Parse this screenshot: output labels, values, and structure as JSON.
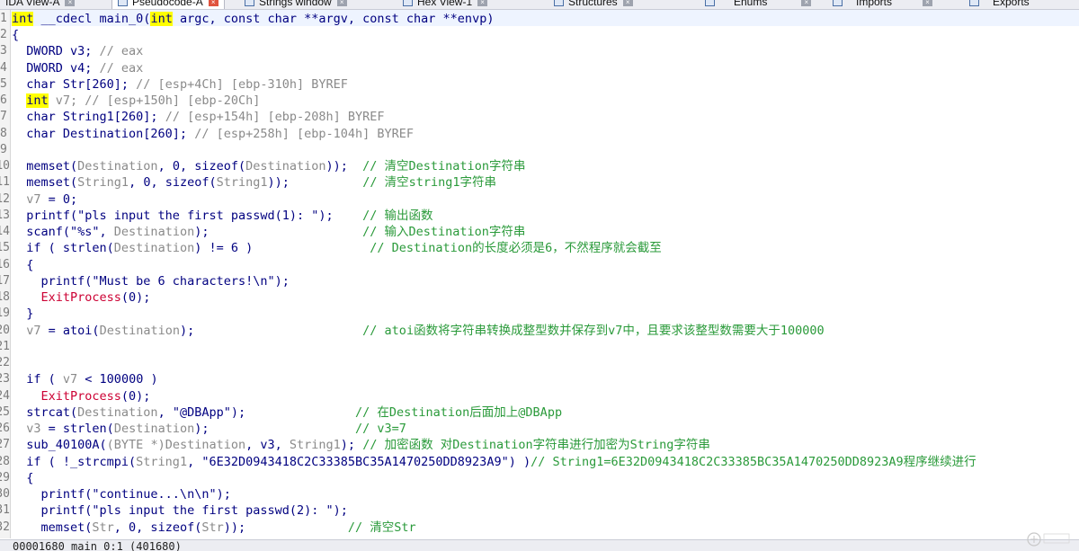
{
  "tabs": [
    {
      "label": "IDA View-A",
      "active": false
    },
    {
      "label": "Pseudocode-A",
      "active": true
    },
    {
      "label": "Strings window",
      "active": false
    },
    {
      "label": "Hex View-1",
      "active": false
    },
    {
      "label": "Structures",
      "active": false
    },
    {
      "label": "Enums",
      "active": false
    },
    {
      "label": "Imports",
      "active": false
    },
    {
      "label": "Exports",
      "active": false
    }
  ],
  "line_numbers": [
    "1",
    "2",
    "3",
    "4",
    "5",
    "6",
    "7",
    "8",
    "9",
    "10",
    "11",
    "12",
    "13",
    "14",
    "15",
    "16",
    "17",
    "18",
    "19",
    "20",
    "21",
    "22",
    "23",
    "24",
    "25",
    "26",
    "27",
    "28",
    "29",
    "30",
    "31",
    "32"
  ],
  "code": {
    "l1a": "int",
    "l1b": " __cdecl main_0(",
    "l1c": "int",
    "l1d": " argc, const char **argv, const char **envp)",
    "l2": "{",
    "l3a": "  DWORD v3; ",
    "l3b": "// eax",
    "l4a": "  DWORD v4; ",
    "l4b": "// eax",
    "l5a": "  char Str[260]; ",
    "l5b": "// [esp+4Ch] [ebp-310h] BYREF",
    "l6a": "int",
    "l6b": " v7; ",
    "l6c": "// [esp+150h] [ebp-20Ch]",
    "l7a": "  char String1[260]; ",
    "l7b": "// [esp+154h] [ebp-208h] BYREF",
    "l8a": "  char Destination[260]; ",
    "l8b": "// [esp+258h] [ebp-104h] BYREF",
    "l10a": "  memset(",
    "l10b": "Destination",
    "l10c": ", 0, sizeof(",
    "l10d": "Destination",
    "l10e": "));  ",
    "l10f": "// 清空Destination字符串",
    "l11a": "  memset(",
    "l11b": "String1",
    "l11c": ", 0, sizeof(",
    "l11d": "String1",
    "l11e": "));          ",
    "l11f": "// 清空string1字符串",
    "l12a": "  ",
    "l12b": "v7",
    "l12c": " = 0;",
    "l13a": "  printf(\"pls input the first passwd(1): \");    ",
    "l13b": "// 输出函数",
    "l14a": "  scanf(\"%s\", ",
    "l14b": "Destination",
    "l14c": ");                     ",
    "l14d": "// 输入Destination字符串",
    "l15a": "  if ( strlen(",
    "l15b": "Destination",
    "l15c": ") != 6 )                ",
    "l15d": "// Destination的长度必须是6，不然程序就会截至",
    "l16": "  {",
    "l17": "    printf(\"Must be 6 characters!\\n\");",
    "l18a": "    ",
    "l18b": "ExitProcess",
    "l18c": "(0);",
    "l19": "  }",
    "l20a": "  ",
    "l20b": "v7",
    "l20c": " = atoi(",
    "l20d": "Destination",
    "l20e": ");                       ",
    "l20f": "// atoi函数将字符串转换成整型数并保存到v7中，且要求该整型数需要大于100000",
    "l23a": "  if ( ",
    "l23b": "v7",
    "l23c": " < 100000 )",
    "l24a": "    ",
    "l24b": "ExitProcess",
    "l24c": "(0);",
    "l25a": "  strcat(",
    "l25b": "Destination",
    "l25c": ", \"@DBApp\");               ",
    "l25d": "// 在Destination后面加上@DBApp",
    "l26a": "  ",
    "l26b": "v3",
    "l26c": " = strlen(",
    "l26d": "Destination",
    "l26e": ");                    ",
    "l26f": "// v3=7",
    "l27a": "  sub_40100A(",
    "l27b": "(BYTE *)",
    "l27c": "Destination",
    "l27d": ", v3, ",
    "l27e": "String1",
    "l27f": "); ",
    "l27g": "// 加密函数 对Destination字符串进行加密为String字符串",
    "l28a": "  if ( !_strcmpi(",
    "l28b": "String1",
    "l28c": ", \"6E32D0943418C2C33385BC35A1470250DD8923A9\") )",
    "l28d": "// String1=6E32D0943418C2C33385BC35A1470250DD8923A9程序继续进行",
    "l29": "  {",
    "l30": "    printf(\"continue...\\n\\n\");",
    "l31": "    printf(\"pls input the first passwd(2): \");",
    "l32a": "    memset(",
    "l32b": "Str",
    "l32c": ", 0, sizeof(",
    "l32d": "Str",
    "l32e": "));              ",
    "l32f": "// 清空Str"
  },
  "status": {
    "text": "00001680 main_0:1 (401680)"
  },
  "colors": {
    "keyword": "#000080",
    "comment": "#2a9a3a",
    "variable": "#8a8a8a",
    "api": "#cc0033",
    "highlight": "#ffff00"
  },
  "icons": {
    "tab_icon": "window-icon",
    "tab_close": "close-icon",
    "watermark": "watermark-logo"
  }
}
